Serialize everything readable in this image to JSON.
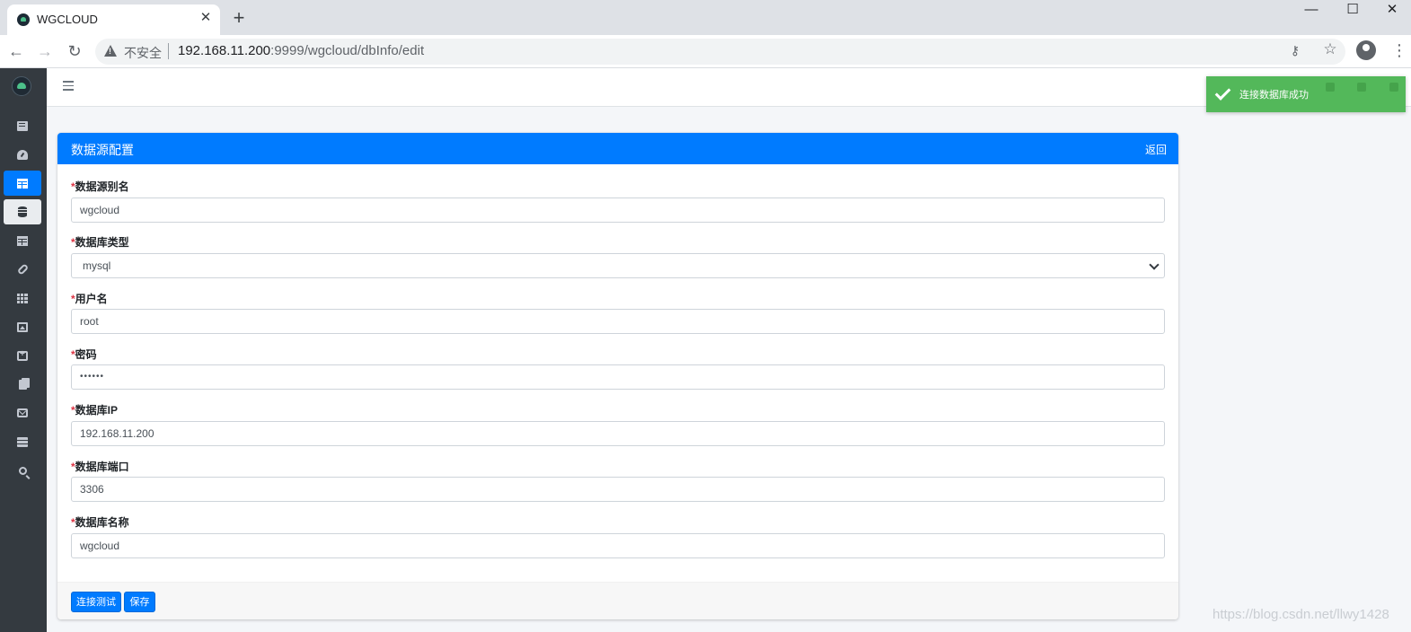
{
  "browser": {
    "tab_title": "WGCLOUD",
    "tab_close": "✕",
    "new_tab": "+",
    "window_controls": {
      "minimize": "—",
      "maximize": "☐",
      "close": "✕"
    },
    "nav": {
      "back": "←",
      "forward": "→",
      "reload": "↻"
    },
    "security_label": "不安全",
    "url_host": "192.168.11.200",
    "url_rest": ":9999/wgcloud/dbInfo/edit",
    "icons": [
      "key-icon",
      "star-icon",
      "profile-icon",
      "menu-icon"
    ]
  },
  "sidebar": {
    "logo": "wgcloud-logo",
    "items": [
      {
        "icon": "book-icon",
        "state": "normal"
      },
      {
        "icon": "gauge-icon",
        "state": "normal"
      },
      {
        "icon": "table-icon",
        "state": "active-blue"
      },
      {
        "icon": "database-icon",
        "state": "active-white"
      },
      {
        "icon": "table-icon",
        "state": "normal"
      },
      {
        "icon": "link-icon",
        "state": "normal"
      },
      {
        "icon": "grid-icon",
        "state": "normal"
      },
      {
        "icon": "image-icon",
        "state": "normal"
      },
      {
        "icon": "plus-square-icon",
        "state": "normal"
      },
      {
        "icon": "copy-icon",
        "state": "normal"
      },
      {
        "icon": "mail-icon",
        "state": "normal"
      },
      {
        "icon": "server-icon",
        "state": "normal"
      },
      {
        "icon": "zoom-icon",
        "state": "normal"
      }
    ]
  },
  "topnav": {
    "menu_toggle": "hamburger-icon"
  },
  "card": {
    "title": "数据源配置",
    "back_link": "返回",
    "fields": [
      {
        "required": "*",
        "label": "数据源别名",
        "value": "wgcloud",
        "type": "text"
      },
      {
        "required": "*",
        "label": "数据库类型",
        "value": "mysql",
        "type": "select"
      },
      {
        "required": "*",
        "label": "用户名",
        "value": "root",
        "type": "text"
      },
      {
        "required": "*",
        "label": "密码",
        "value": "••••••",
        "type": "password"
      },
      {
        "required": "*",
        "label": "数据库IP",
        "value": "192.168.11.200",
        "type": "text"
      },
      {
        "required": "*",
        "label": "数据库端口",
        "value": "3306",
        "type": "text"
      },
      {
        "required": "*",
        "label": "数据库名称",
        "value": "wgcloud",
        "type": "text"
      }
    ],
    "buttons": {
      "test": "连接测试",
      "save": "保存"
    }
  },
  "toast": {
    "message": "连接数据库成功"
  },
  "watermark": "https://blog.csdn.net/llwy1428",
  "colors": {
    "primary": "#007bff",
    "sidebar_bg": "#343a40",
    "toast_bg": "#53b85a",
    "required": "#dc3545"
  }
}
